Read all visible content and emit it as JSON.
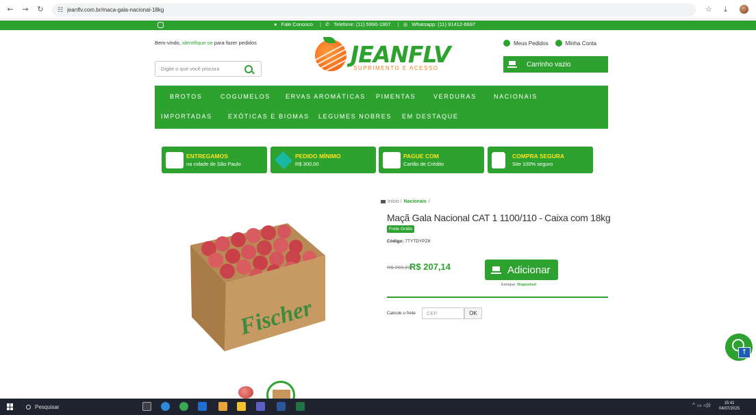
{
  "browser": {
    "url": "jeanflv.com.br/maca-gala-nacional-18kg"
  },
  "topbar": {
    "contact": "Fale Conosco",
    "phone": "Telefone: (11) 5990-1907",
    "whatsapp": "Whatsapp: (11) 91412-6697"
  },
  "header": {
    "welcome_prefix": "Bem-vindo,",
    "welcome_link": "identifique-se",
    "welcome_suffix": "para fazer pedidos",
    "search_placeholder": "Digite o que você procura",
    "brand": "JEANFLV",
    "tagline": "SUPRIMENTO E ACESSO",
    "orders": "Meus Pedidos",
    "account": "Minha Conta",
    "cart": "Carrinho vazio"
  },
  "nav": {
    "items": [
      "BROTOS",
      "COGUMELOS",
      "ERVAS AROMÁTICAS",
      "PIMENTAS",
      "VERDURAS",
      "NACIONAIS",
      "IMPORTADAS",
      "EXÓTICAS E BIOMAS",
      "LEGUMES NOBRES",
      "EM DESTAQUE"
    ]
  },
  "badges": [
    {
      "title": "ENTREGAMOS",
      "sub": "na cidade de São Paulo"
    },
    {
      "title": "PEDIDO MÍNIMO",
      "sub": "R$ 300,00"
    },
    {
      "title": "PAGUE COM",
      "sub": "Cartão de Crédito"
    },
    {
      "title": "COMPRA SEGURA",
      "sub": "Site 100% seguro"
    }
  ],
  "product": {
    "breadcrumb_home": "Início",
    "breadcrumb_category": "Nacionais",
    "title": "Maçã Gala Nacional CAT 1 1100/110 - Caixa com 18kg",
    "free_shipping": "Frete Grátis",
    "code_label": "Código:",
    "code_value": "7TYTDYPZ8",
    "old_price": "R$ 269,23",
    "price": "R$ 207,14",
    "add_button": "Adicionar",
    "stock_label": "Estoque:",
    "stock_value": "Disponível",
    "shipping_label": "Calcule o frete",
    "cep_placeholder": "CEP",
    "ok": "OK",
    "box_brand": "Fischer"
  },
  "taskbar": {
    "search": "Pesquisar",
    "time": "15:41",
    "date": "04/07/2025"
  },
  "colors": {
    "brand_green": "#2ea22f",
    "accent_orange": "#f07a1e",
    "accent_yellow": "#ffe21f"
  }
}
